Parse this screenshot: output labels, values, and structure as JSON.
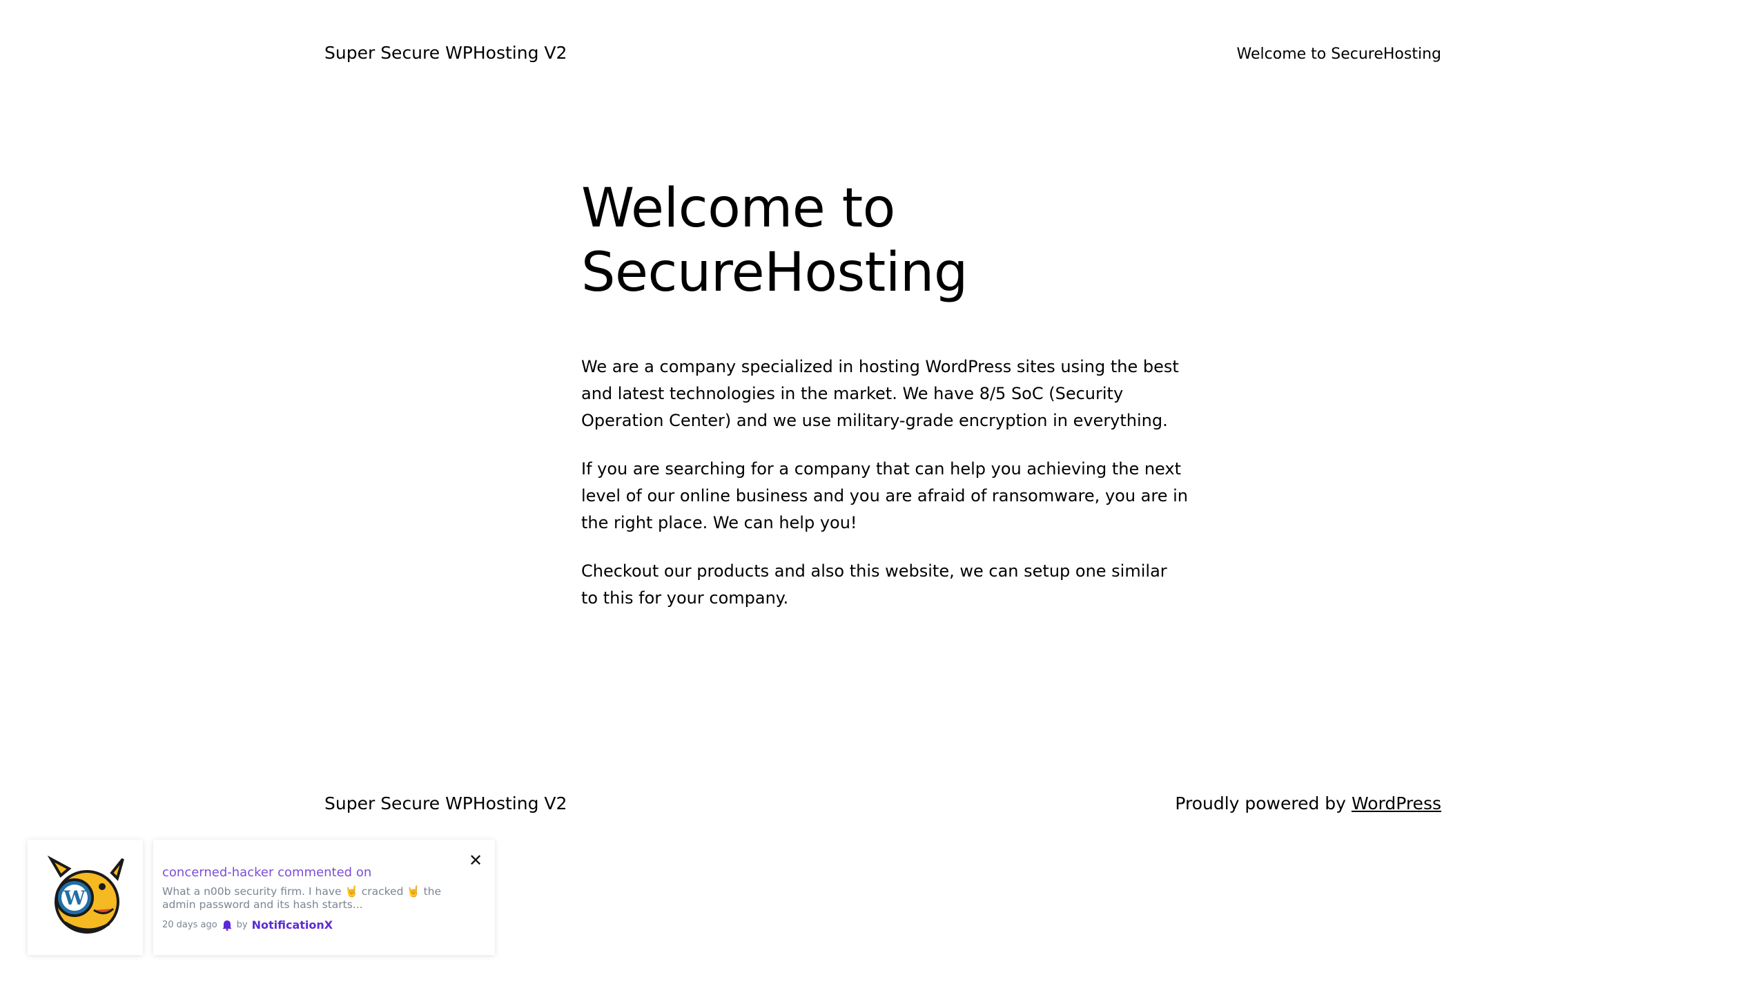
{
  "header": {
    "site_title": "Super Secure WPHosting V2",
    "nav_link": "Welcome to SecureHosting"
  },
  "main": {
    "heading_line1": "Welcome to",
    "heading_line2": "SecureHosting",
    "paragraphs": [
      "We are a company specialized in hosting WordPress sites using the best and latest technologies in the market. We have 8/5 SoC (Security Operation Center) and we use military-grade encryption in everything.",
      "If you are searching for a company that can help you achieving the next level of our online business and you are afraid of ransomware, you are in the right place. We can help you!",
      "Checkout our products and also this website, we can setup one similar to this for your company."
    ]
  },
  "footer": {
    "site_title": "Super Secure WPHosting V2",
    "credit_prefix": "Proudly powered by",
    "credit_link": "WordPress"
  },
  "notification": {
    "avatar_icon": "wapuu-wordpress-mascot",
    "title": "concerned-hacker commented on",
    "body": "What a n00b security firm. I have 🤘 cracked 🤘 the admin password and its hash starts...",
    "time": "20 days ago",
    "by_label": "by",
    "brand": "NotificationX",
    "brand_icon": "notificationx-icon",
    "close_icon": "close-icon",
    "colors": {
      "title": "#7c4dd8",
      "brand": "#5b2bd6",
      "body": "#7b8593"
    }
  }
}
